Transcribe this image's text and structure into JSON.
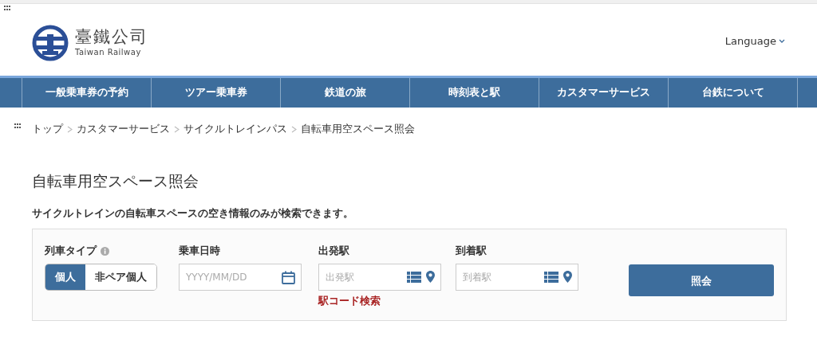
{
  "header": {
    "logo_name": "臺鐵公司",
    "logo_subtitle": "Taiwan Railway",
    "language": "Language"
  },
  "nav": [
    {
      "label": "一般乗車券の予約"
    },
    {
      "label": "ツアー乗車券"
    },
    {
      "label": "鉄道の旅"
    },
    {
      "label": "時刻表と駅"
    },
    {
      "label": "カスタマーサービス"
    },
    {
      "label": "台鉄について"
    }
  ],
  "breadcrumb": [
    {
      "label": "トップ"
    },
    {
      "label": "カスタマーサービス"
    },
    {
      "label": "サイクルトレインパス"
    },
    {
      "label": "自転車用空スペース照会"
    }
  ],
  "title": "自転車用空スペース照会",
  "description": "サイクルトレインの自転車スペースの空き情報のみが検索できます。",
  "form": {
    "train_type": {
      "label": "列車タイプ",
      "options": [
        {
          "label": "個人",
          "selected": true
        },
        {
          "label": "非ペア個人",
          "selected": false
        }
      ]
    },
    "date": {
      "label": "乗車日時",
      "placeholder": "YYYY/MM/DD"
    },
    "departure": {
      "label": "出発駅",
      "placeholder": "出発駅",
      "link": "駅コード検索"
    },
    "arrival": {
      "label": "到着駅",
      "placeholder": "到着駅"
    },
    "submit": "照会"
  }
}
